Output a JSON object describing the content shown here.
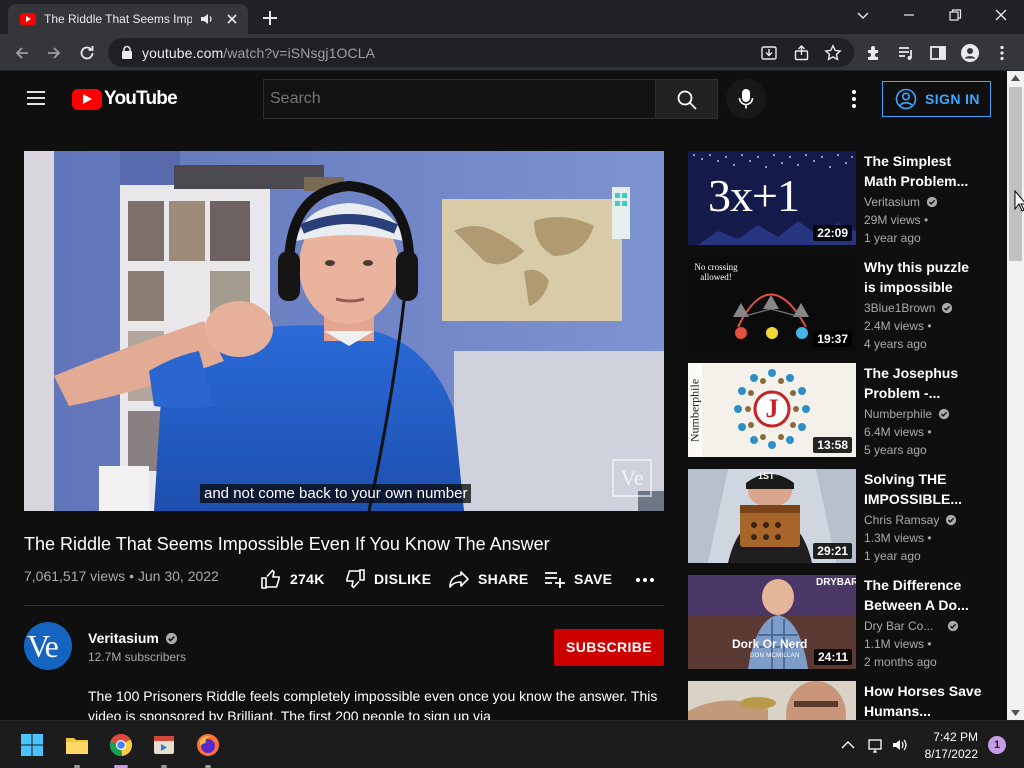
{
  "browser": {
    "tab": {
      "title": "The Riddle That Seems Impossible Even If You Know The Answer",
      "favicon": "youtube-favicon",
      "audio_icon": "speaker-icon"
    },
    "url": {
      "host": "youtube.com",
      "path": "/watch?v=iSNsgj1OCLA"
    }
  },
  "masthead": {
    "logo_text": "YouTube",
    "search_placeholder": "Search",
    "signin_label": "SIGN IN",
    "accent": "#3ea6ff",
    "brand": "#ff0000"
  },
  "player": {
    "caption": "and not come back to your own number",
    "watermark": "Ve"
  },
  "video": {
    "title": "The Riddle That Seems Impossible Even If You Know The Answer",
    "views": "7,061,517 views",
    "date": "Jun 30, 2022",
    "likes": "274K",
    "dislike_label": "DISLIKE",
    "share_label": "SHARE",
    "save_label": "SAVE"
  },
  "channel": {
    "avatar_text": "Ve",
    "name": "Veritasium",
    "subscribers": "12.7M subscribers",
    "subscribe_label": "SUBSCRIBE",
    "subscribe_color": "#cc0000"
  },
  "description": "The 100 Prisoners Riddle feels completely impossible even once you know the answer. This video is sponsored by Brilliant. The first 200 people to sign up via",
  "recommendations": [
    {
      "title": "The Simplest Math Problem...",
      "channel": "Veritasium",
      "verified": true,
      "views": "29M views",
      "age": "1 year ago",
      "duration": "22:09",
      "thumb_text": "3x+1"
    },
    {
      "title": "Why this puzzle is impossible",
      "channel": "3Blue1Brown",
      "verified": true,
      "views": "2.4M views",
      "age": "4 years ago",
      "duration": "19:37",
      "thumb_text": "No crossing allowed!"
    },
    {
      "title": "The Josephus Problem -...",
      "channel": "Numberphile",
      "verified": true,
      "views": "6.4M views",
      "age": "5 years ago",
      "duration": "13:58",
      "thumb_text": "Numberphile",
      "thumb_letter": "J"
    },
    {
      "title": "Solving THE IMPOSSIBLE...",
      "channel": "Chris Ramsay",
      "verified": true,
      "views": "1.3M views",
      "age": "1 year ago",
      "duration": "29:21",
      "thumb_text": "1ST"
    },
    {
      "title": "The Difference Between A Do...",
      "channel": "Dry Bar Co...",
      "verified": true,
      "views": "1.1M views",
      "age": "2 months ago",
      "duration": "24:11",
      "thumb_text": "Dork Or Nerd",
      "thumb_sub": "DON MCMILLAN",
      "thumb_brand": "DRYBAR"
    },
    {
      "title": "How Horses Save Humans...",
      "channel": "",
      "verified": false,
      "views": "",
      "age": "",
      "duration": ""
    }
  ],
  "taskbar": {
    "time": "7:42 PM",
    "date": "8/17/2022",
    "notifications": "1"
  }
}
